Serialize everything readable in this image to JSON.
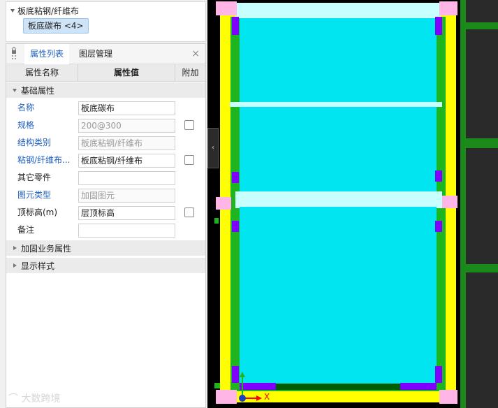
{
  "tree": {
    "root_label": "板底粘钢/纤维布",
    "child_label": "板底碳布 <4>"
  },
  "tabs": [
    {
      "label": "属性列表"
    },
    {
      "label": "图层管理"
    }
  ],
  "close_glyph": "×",
  "table_headers": {
    "name": "属性名称",
    "value": "属性值",
    "extra": "附加"
  },
  "sections": {
    "basic": "基础属性",
    "reinforce": "加固业务属性",
    "display": "显示样式"
  },
  "rows": [
    {
      "name": "名称",
      "value": "板底碳布",
      "name_color": "blue",
      "value_grey": false,
      "checkbox": false
    },
    {
      "name": "规格",
      "value": "200@300",
      "name_color": "blue",
      "value_grey": true,
      "checkbox": true
    },
    {
      "name": "结构类别",
      "value": "板底粘钢/纤维布",
      "name_color": "blue",
      "value_grey": true,
      "checkbox": false
    },
    {
      "name": "粘钢/纤维布...",
      "value": "板底粘钢/纤维布",
      "name_color": "blue",
      "value_grey": false,
      "checkbox": true
    },
    {
      "name": "其它零件",
      "value": "",
      "name_color": "black",
      "value_grey": false,
      "checkbox": false
    },
    {
      "name": "图元类型",
      "value": "加固图元",
      "name_color": "blue",
      "value_grey": true,
      "checkbox": false
    },
    {
      "name": "顶标高(m)",
      "value": "层顶标高",
      "name_color": "black",
      "value_grey": false,
      "checkbox": true
    },
    {
      "name": "备注",
      "value": "",
      "name_color": "black",
      "value_grey": false,
      "checkbox": false
    }
  ],
  "watermark": "大数跨境",
  "axis_x_label": "X",
  "colors": {
    "cyan": "#00e5f0",
    "yellow": "#ffff00",
    "green": "#1fb51f",
    "purple": "#8000ff",
    "pink": "#ffb6e6",
    "lightcyan": "#c8ffff",
    "darkgreen": "#005c00",
    "tabblue": "#1f5fbf"
  }
}
